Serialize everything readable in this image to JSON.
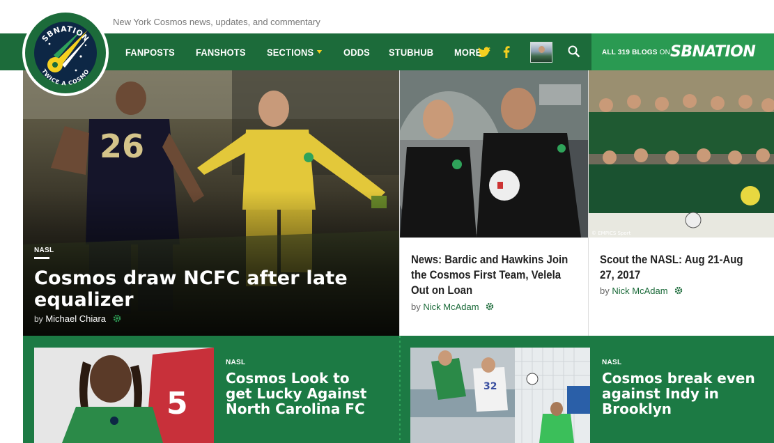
{
  "site": {
    "tagline": "New York Cosmos news, updates, and commentary",
    "logo_text_top": "SBNATION",
    "logo_text_bottom": "TWICE A COSMO"
  },
  "nav": {
    "items": [
      {
        "label": "FANPOSTS",
        "has_caret": false
      },
      {
        "label": "FANSHOTS",
        "has_caret": false
      },
      {
        "label": "SECTIONS",
        "has_caret": true
      },
      {
        "label": "ODDS",
        "has_caret": false
      },
      {
        "label": "STUBHUB",
        "has_caret": false
      },
      {
        "label": "MORE",
        "has_caret": true
      }
    ],
    "blogs_prefix": "ALL 319 BLOGS",
    "blogs_on": "ON",
    "brand": "SBNATION"
  },
  "colors": {
    "nav_green": "#1c6b3a",
    "brand_green": "#2a9a52",
    "accent_yellow": "#f5d020"
  },
  "hero": {
    "kicker": "NASL",
    "title": "Cosmos draw NCFC after late equalizer",
    "by": "by",
    "author": "Michael Chiara"
  },
  "tiles": [
    {
      "title": "News: Bardic and Hawkins Join the Cosmos First Team, Velela Out on Loan",
      "by": "by",
      "author": "Nick McAdam"
    },
    {
      "title": "Scout the NASL: Aug 21-Aug 27, 2017",
      "by": "by",
      "author": "Nick McAdam",
      "photo_credit": "© EMPICS Sport"
    }
  ],
  "bottom": [
    {
      "kicker": "NASL",
      "title": "Cosmos Look to get Lucky Against North Carolina FC"
    },
    {
      "kicker": "NASL",
      "title": "Cosmos break even against Indy in Brooklyn"
    }
  ]
}
